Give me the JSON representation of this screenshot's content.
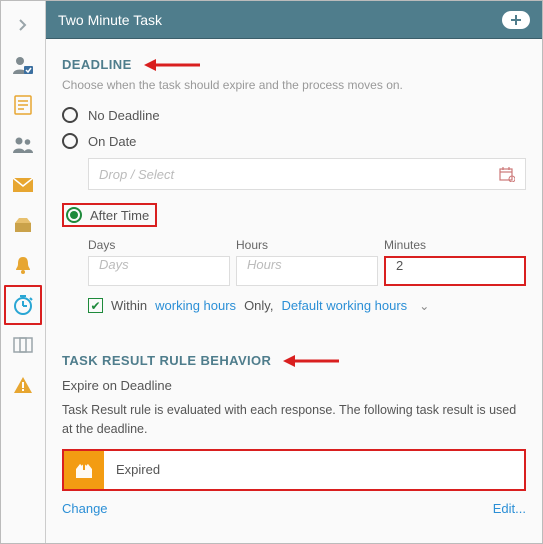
{
  "header": {
    "title": "Two Minute Task"
  },
  "deadline": {
    "section_title": "DEADLINE",
    "subtext": "Choose when the task should expire and the process moves on.",
    "options": {
      "none": "No Deadline",
      "on_date": "On Date",
      "after_time": "After Time"
    },
    "date_placeholder": "Drop / Select",
    "time": {
      "days_label": "Days",
      "hours_label": "Hours",
      "minutes_label": "Minutes",
      "days_placeholder": "Days",
      "hours_placeholder": "Hours",
      "minutes_value": "2"
    },
    "working_hours": {
      "prefix": "Within",
      "link1": "working hours",
      "mid": "Only,",
      "link2": "Default working hours"
    }
  },
  "task_result": {
    "section_title": "TASK RESULT RULE BEHAVIOR",
    "label": "Expire on Deadline",
    "description": "Task Result rule is evaluated with each response. The following task result is used at the deadline.",
    "result_name": "Expired",
    "change": "Change",
    "edit": "Edit..."
  }
}
